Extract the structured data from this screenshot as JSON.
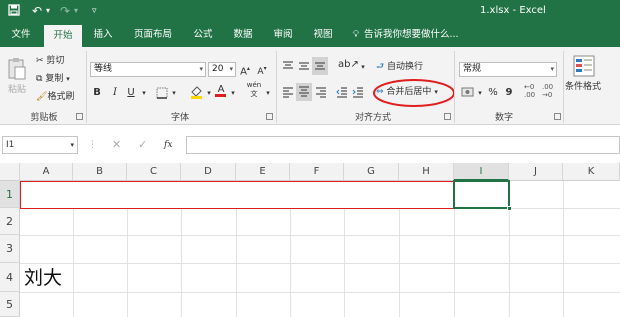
{
  "window": {
    "title": "1.xlsx - Excel"
  },
  "tabs": [
    "文件",
    "开始",
    "插入",
    "页面布局",
    "公式",
    "数据",
    "审阅",
    "视图"
  ],
  "tell_me": "告诉我你想要做什么...",
  "clipboard": {
    "paste": "粘贴",
    "cut": "剪切",
    "copy": "复制",
    "format_painter": "格式刷",
    "label": "剪贴板"
  },
  "font": {
    "name": "等线",
    "size": "20",
    "bold": "B",
    "italic": "I",
    "underline": "U",
    "phonetic": "wén",
    "label": "字体"
  },
  "alignment": {
    "wrap_text": "自动换行",
    "merge_center": "合并后居中",
    "label": "对齐方式"
  },
  "number": {
    "format": "常规",
    "percent": "%",
    "comma": "9",
    "label": "数字"
  },
  "styles": {
    "conditional": "条件格式"
  },
  "formula_bar": {
    "name_box": "I1",
    "fx": "fx",
    "value": ""
  },
  "columns": [
    "A",
    "B",
    "C",
    "D",
    "E",
    "F",
    "G",
    "H",
    "I",
    "J",
    "K"
  ],
  "rows": [
    "1",
    "2",
    "3",
    "4",
    "5"
  ],
  "cells": {
    "A4": "刘大"
  },
  "colors": {
    "excel_green": "#217346",
    "highlight_red": "#e01e1e"
  }
}
